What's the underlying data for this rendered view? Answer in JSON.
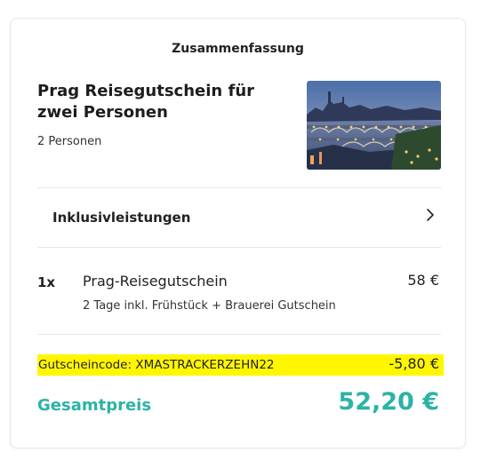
{
  "summary": {
    "title": "Zusammenfassung"
  },
  "product": {
    "title": "Prag Reisegutschein für zwei Personen",
    "persons": "2 Personen",
    "image": "prague-bridges-photo"
  },
  "inclusions": {
    "label": "Inklusivleistungen",
    "icon": "chevron-right-icon"
  },
  "line_item": {
    "quantity": "1x",
    "name": "Prag-Reisegutschein",
    "price": "58 €",
    "description": "2 Tage inkl. Frühstück + Brauerei Gutschein"
  },
  "voucher": {
    "code_text": "Gutscheincode: XMASTRACKERZEHN22",
    "amount": "-5,80 €",
    "highlight_color": "#fff600"
  },
  "total": {
    "label": "Gesamtpreis",
    "value": "52,20 €",
    "accent_color": "#2bb3a6"
  }
}
